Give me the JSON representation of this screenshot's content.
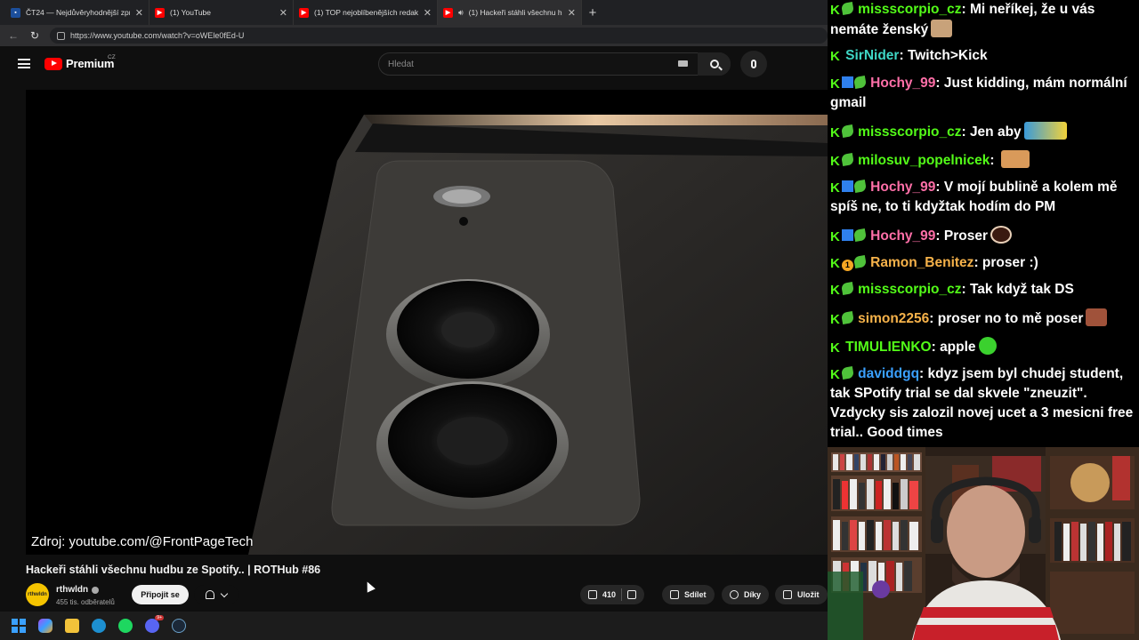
{
  "browser": {
    "tabs": [
      {
        "label": "ČT24 — Nejdůvěryhodnější zpravo",
        "favicon": "ct24",
        "active": false
      },
      {
        "label": "(1) YouTube",
        "favicon": "youtube",
        "active": false
      },
      {
        "label": "(1) TOP nejoblíbenějších redakčních",
        "favicon": "youtube",
        "active": false
      },
      {
        "label": "(1) Hackeři stáhli všechnu hudb",
        "favicon": "youtube",
        "active": true,
        "audio": true
      }
    ],
    "url": "https://www.youtube.com/watch?v=oWEle0fEd-U"
  },
  "youtube": {
    "brand": "Premium",
    "region": "CZ",
    "search_placeholder": "Hledat",
    "video_caption": "Zdroj: youtube.com/@FrontPageTech",
    "video_title": "Hackeři stáhli všechnu hudbu ze Spotify.. | ROTHub #86",
    "channel": {
      "avatar_text": "rthwldn",
      "name": "rthwldn",
      "subscribers": "455 tis. odběratelů",
      "subscribe_label": "Připojit se"
    },
    "actions": {
      "likes": "410",
      "share": "Sdílet",
      "thanks": "Díky",
      "save": "Uložit"
    }
  },
  "chat": {
    "messages": [
      {
        "user": "missscorpio_cz",
        "color": "#53fc18",
        "badges": [
          "kick",
          "leaf"
        ],
        "text": "Mi neříkej, že u vás nemáte ženský",
        "emote": "face"
      },
      {
        "user": "SirNider",
        "color": "#3fd7c6",
        "badges": [
          "kick"
        ],
        "text": "Twitch>Kick"
      },
      {
        "user": "Hochy_99",
        "color": "#ff6fa8",
        "badges": [
          "kick",
          "arrow",
          "leaf"
        ],
        "text": "Just kidding, mám normální gmail"
      },
      {
        "user": "missscorpio_cz",
        "color": "#53fc18",
        "badges": [
          "kick",
          "leaf"
        ],
        "text": "Jen aby",
        "emote": "minion"
      },
      {
        "user": "milosuv_popelnicek",
        "color": "#53fc18",
        "badges": [
          "kick",
          "leaf"
        ],
        "text": "",
        "emote": "cat"
      },
      {
        "user": "Hochy_99",
        "color": "#ff6fa8",
        "badges": [
          "kick",
          "arrow",
          "leaf"
        ],
        "text": "V mojí bublině a kolem mě spíš ne, to ti kdyžtak hodím do PM"
      },
      {
        "user": "Hochy_99",
        "color": "#ff6fa8",
        "badges": [
          "kick",
          "arrow",
          "leaf"
        ],
        "text": "Proser",
        "emote": "ring"
      },
      {
        "user": "Ramon_Benitez",
        "color": "#f6b24a",
        "badges": [
          "kick",
          "one",
          "leaf"
        ],
        "text": "proser :)"
      },
      {
        "user": "missscorpio_cz",
        "color": "#53fc18",
        "badges": [
          "kick",
          "leaf"
        ],
        "text": "Tak když tak DS"
      },
      {
        "user": "simon2256",
        "color": "#f6b24a",
        "badges": [
          "kick",
          "leaf"
        ],
        "text": "proser no to mě poser",
        "emote": "face2"
      },
      {
        "user": "TIMULIENKO",
        "color": "#53fc18",
        "badges": [
          "kick"
        ],
        "text": "apple",
        "emote": "apple"
      },
      {
        "user": "daviddgq",
        "color": "#3aa0ff",
        "badges": [
          "kick",
          "leaf"
        ],
        "text": "kdyz jsem byl chudej student, tak SPotify trial se dal skvele \"zneuzit\". Vzdycky sis zalozil novej ucet a 3 mesicni free trial.. Good times"
      }
    ]
  },
  "taskbar": {
    "discord_badge": "9+"
  },
  "colors": {
    "yt_red": "#ff0000",
    "kick_green": "#53fc18",
    "background": "#0f0f0f"
  }
}
